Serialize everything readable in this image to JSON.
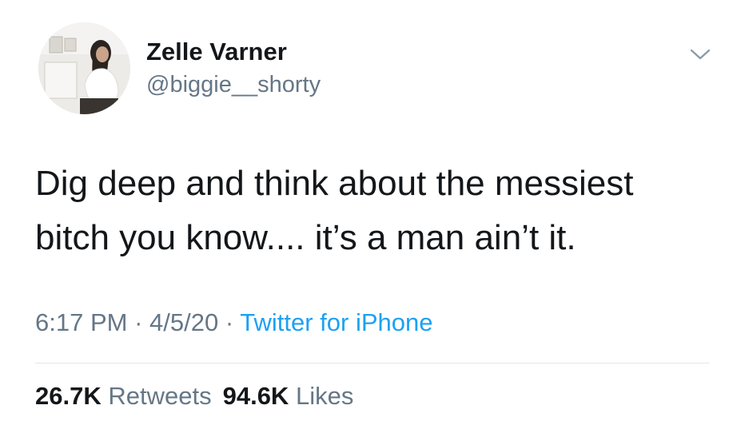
{
  "user": {
    "display_name": "Zelle Varner",
    "handle": "@biggie__shorty"
  },
  "tweet": {
    "text_lines": [
      "Dig deep and think about the messiest",
      "bitch you know.... it’s a man ain’t it."
    ],
    "time": "6:17 PM",
    "date": "4/5/20",
    "separator": "·",
    "source": "Twitter for iPhone"
  },
  "stats": {
    "retweets_count": "26.7K",
    "retweets_label": "Retweets",
    "likes_count": "94.6K",
    "likes_label": "Likes"
  },
  "colors": {
    "text": "#14171a",
    "secondary": "#657786",
    "link": "#1da1f2",
    "divider": "#e1e8ed"
  },
  "icons": {
    "menu": "chevron-down-icon"
  }
}
